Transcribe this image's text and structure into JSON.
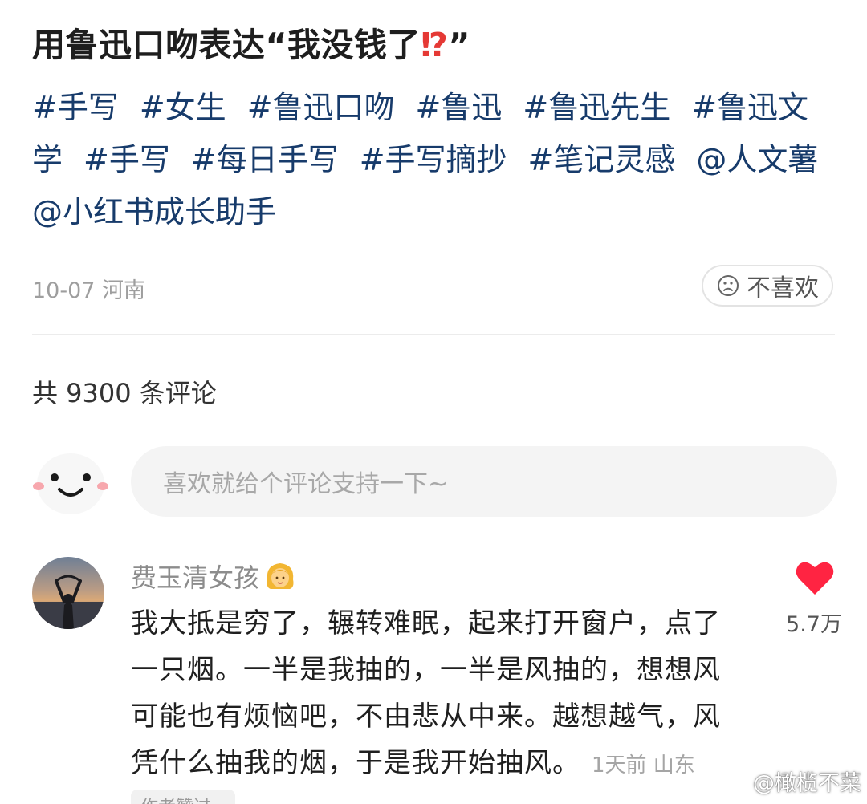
{
  "post": {
    "title": "用鲁迅口吻表达“我没钱了",
    "title_emoji": "⁉",
    "title_end": "”",
    "tags": [
      "#手写",
      "#女生",
      "#鲁迅口吻",
      "#鲁迅",
      "#鲁迅先生",
      "#鲁迅文学",
      "#手写",
      "#每日手写",
      "#手写摘抄",
      "#笔记灵感"
    ],
    "mentions": [
      "@人文薯",
      "@小红书成长助手"
    ],
    "date_location": "10-07 河南",
    "dislike_label": "不喜欢"
  },
  "comments_header": {
    "count_text": "共 9300 条评论"
  },
  "comment_input": {
    "placeholder": "喜欢就给个评论支持一下~"
  },
  "comment": {
    "username": "费玉清女孩",
    "badge_icon": "girl-emoji-icon",
    "lines": [
      "我大抵是穷了，辗转难眠，起来打开窗户，点了",
      "一只烟。一半是我抽的，一半是风抽的，想想风",
      "可能也有烦恼吧，不由悲从中来。越想越气，风",
      "凭什么抽我的烟，于是我开始抽风。"
    ],
    "timestamp": "1天前 山东",
    "likes": "5.7万",
    "author_tag": "作者赞过"
  },
  "watermark": {
    "text": "@橄榄不菜",
    "icon": "weibo-icon"
  },
  "colors": {
    "tag_blue": "#173b6b",
    "like_red": "#ff2442",
    "meta_gray": "#9e9e9e"
  }
}
